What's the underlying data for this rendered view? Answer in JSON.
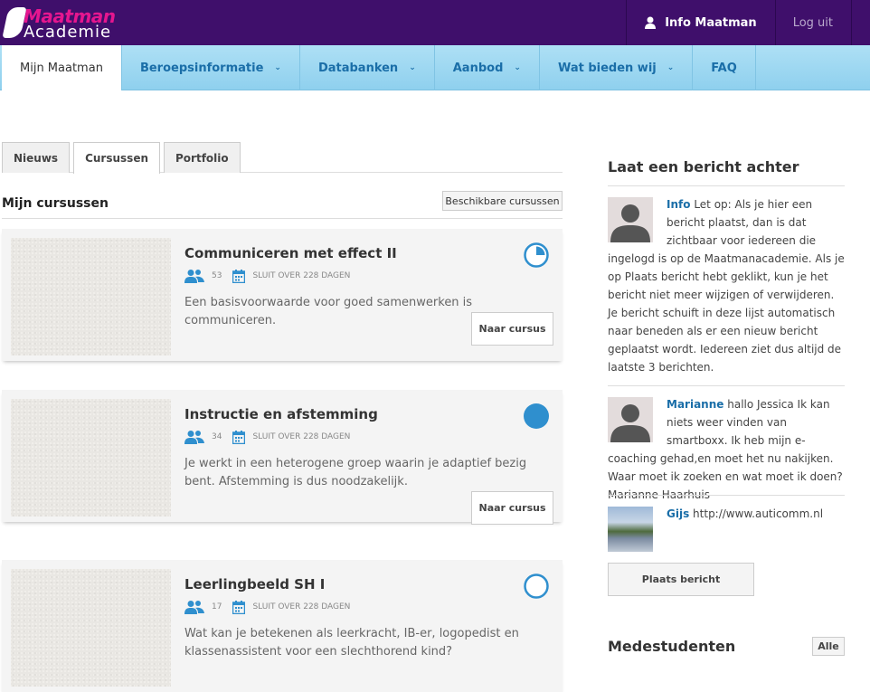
{
  "logo": {
    "line1": "Maatman",
    "line2": "Academie"
  },
  "top": {
    "user_label": "Info Maatman",
    "logout_label": "Log uit"
  },
  "nav": [
    {
      "label": "Mijn Maatman"
    },
    {
      "label": "Beroepsinformatie"
    },
    {
      "label": "Databanken"
    },
    {
      "label": "Aanbod"
    },
    {
      "label": "Wat bieden wij"
    },
    {
      "label": "FAQ"
    }
  ],
  "tabs": [
    {
      "label": "Nieuws"
    },
    {
      "label": "Cursussen"
    },
    {
      "label": "Portfolio"
    }
  ],
  "section": {
    "title": "Mijn cursussen",
    "available_button": "Beschikbare cursussen"
  },
  "courses": [
    {
      "title": "Communiceren met effect II",
      "participants": "53",
      "deadline": "SLUIT OVER 228 DAGEN",
      "description": "Een basisvoorwaarde voor goed samenwerken is communiceren.",
      "button": "Naar cursus",
      "progress": 0.25
    },
    {
      "title": "Instructie en afstemming",
      "participants": "34",
      "deadline": "SLUIT OVER 228 DAGEN",
      "description": "Je werkt in een heterogene groep waarin je adaptief bezig bent. Afstemming is dus noodzakelijk.",
      "button": "Naar cursus",
      "progress": 1.0
    },
    {
      "title": "Leerlingbeeld SH I",
      "participants": "17",
      "deadline": "SLUIT OVER 228 DAGEN",
      "description": "Wat kan je betekenen als leerkracht, IB-er, logopedist en klassenassistent voor een slechthorend kind?",
      "button": "Naar cursus",
      "progress": 0.0
    }
  ],
  "sidebar": {
    "title": "Laat een bericht achter",
    "messages": [
      {
        "name": "Info",
        "text": "Let op: Als je hier een bericht plaatst, dan is dat zichtbaar voor iedereen die ingelogd is op de Maatmanacademie. Als je op Plaats bericht hebt geklikt, kun je het bericht niet meer wijzigen of verwijderen. Je bericht schuift in deze lijst automatisch naar beneden als er een nieuw bericht geplaatst wordt. Iedereen ziet dus altijd de laatste 3 berichten."
      },
      {
        "name": "Marianne",
        "text": "hallo Jessica Ik kan niets weer vinden van smartboxx. Ik heb mijn e-coaching gehad,en moet het nu nakijken. Waar moet ik zoeken en wat moet ik doen? Marianne Haarhuis"
      },
      {
        "name": "Gijs",
        "text": "http://www.auticomm.nl"
      }
    ],
    "place_button": "Plaats bericht",
    "students_title": "Medestudenten",
    "all_button": "Alle"
  },
  "colors": {
    "topbar": "#3f0f6b",
    "brand_pink": "#e5168f",
    "nav_blue": "#8fd0ee",
    "link_blue": "#1a6ea8",
    "progress_blue": "#2f8fce"
  }
}
